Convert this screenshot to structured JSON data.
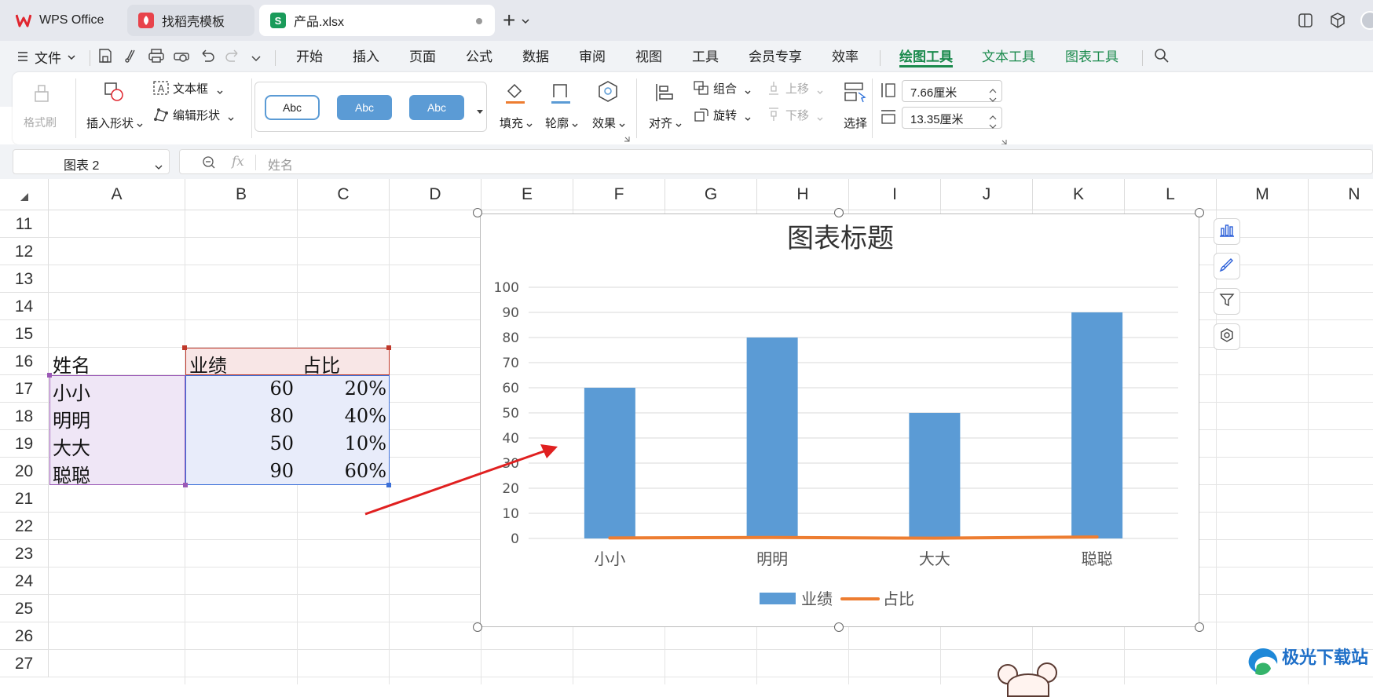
{
  "tabs": [
    {
      "label": "WPS Office",
      "icon": "wps-logo-icon"
    },
    {
      "label": "找稻壳模板",
      "icon": "docer-icon"
    },
    {
      "label": "产品.xlsx",
      "icon": "spreadsheet-s-icon",
      "icon_text": "S"
    }
  ],
  "new_tab_label": "+",
  "menu": {
    "file_label": "文件",
    "items": [
      "开始",
      "插入",
      "页面",
      "公式",
      "数据",
      "审阅",
      "视图",
      "工具",
      "会员专享",
      "效率"
    ],
    "context_items": [
      "绘图工具",
      "文本工具",
      "图表工具"
    ]
  },
  "ribbon": {
    "format_painter": "格式刷",
    "insert_shape": "插入形状",
    "text_box": "文本框",
    "edit_shape": "编辑形状",
    "style_samples": [
      "Abc",
      "Abc",
      "Abc"
    ],
    "fill": "填充",
    "outline": "轮廓",
    "effect": "效果",
    "align": "对齐",
    "group": "组合",
    "rotate": "旋转",
    "bring_forward": "上移",
    "send_backward": "下移",
    "select": "选择",
    "height_value": "7.66厘米",
    "width_value": "13.35厘米"
  },
  "formula_bar": {
    "name_box": "图表 2",
    "fx_label": "fx",
    "content": "姓名"
  },
  "columns": [
    "A",
    "B",
    "C",
    "D",
    "E",
    "F",
    "G",
    "H",
    "I",
    "J",
    "K",
    "L",
    "M",
    "N"
  ],
  "rows": [
    "11",
    "12",
    "13",
    "14",
    "15",
    "16",
    "17",
    "18",
    "19",
    "20",
    "21",
    "22",
    "23",
    "24",
    "25",
    "26",
    "27"
  ],
  "table": {
    "header": [
      "姓名",
      "业绩",
      "占比"
    ],
    "rows": [
      [
        "小小",
        "60",
        "20%"
      ],
      [
        "明明",
        "80",
        "40%"
      ],
      [
        "大大",
        "50",
        "10%"
      ],
      [
        "聪聪",
        "90",
        "60%"
      ]
    ]
  },
  "chart_data": {
    "type": "bar",
    "title": "图表标题",
    "categories": [
      "小小",
      "明明",
      "大大",
      "聪聪"
    ],
    "series": [
      {
        "name": "业绩",
        "type": "bar",
        "values": [
          60,
          80,
          50,
          90
        ],
        "color": "#5b9bd5"
      },
      {
        "name": "占比",
        "type": "line",
        "values": [
          0.2,
          0.4,
          0.1,
          0.6
        ],
        "color": "#ed7d31"
      }
    ],
    "yticks": [
      "0",
      "10",
      "20",
      "30",
      "40",
      "50",
      "60",
      "70",
      "80",
      "90",
      "100"
    ],
    "ylim": [
      0,
      100
    ],
    "grid": true,
    "legend": "bottom"
  },
  "colors": {
    "accent_green": "#1a8a4c",
    "name_range": "#9b59b6",
    "header_range": "#c0392b",
    "data_range": "#3b6fd8",
    "arrow": "#e02020"
  },
  "watermark": "极光下载站"
}
